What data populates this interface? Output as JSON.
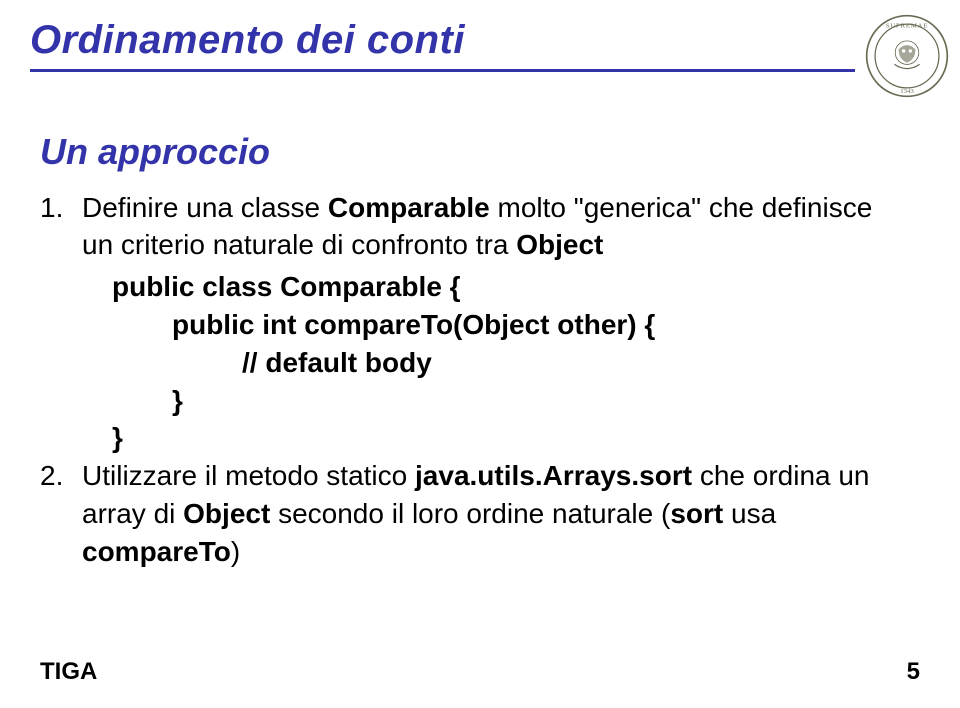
{
  "header": {
    "title": "Ordinamento dei conti"
  },
  "subtitle": "Un approccio",
  "item1": {
    "num": "1.",
    "pre": "Definire una classe ",
    "bold1": "Comparable",
    "mid": " molto \"generica\" che definisce un criterio naturale di confronto tra ",
    "bold2": "Object"
  },
  "code": {
    "l1a": "public class Comparable {",
    "l2a": "public int compareTo(Object other) {",
    "l3a": "// default body",
    "l4a": "}",
    "l5a": "}"
  },
  "item2": {
    "num": "2.",
    "pre": "Utilizzare il metodo statico ",
    "bold1": "java.utils.Arrays.sort",
    "mid1": " che ordina un array di ",
    "bold2": "Object",
    "mid2": " secondo il loro ordine naturale (",
    "bold3": "sort",
    "mid3": " usa ",
    "bold4": "compareTo",
    "mid4": ")"
  },
  "footer": {
    "left": "TIGA",
    "right": "5"
  }
}
